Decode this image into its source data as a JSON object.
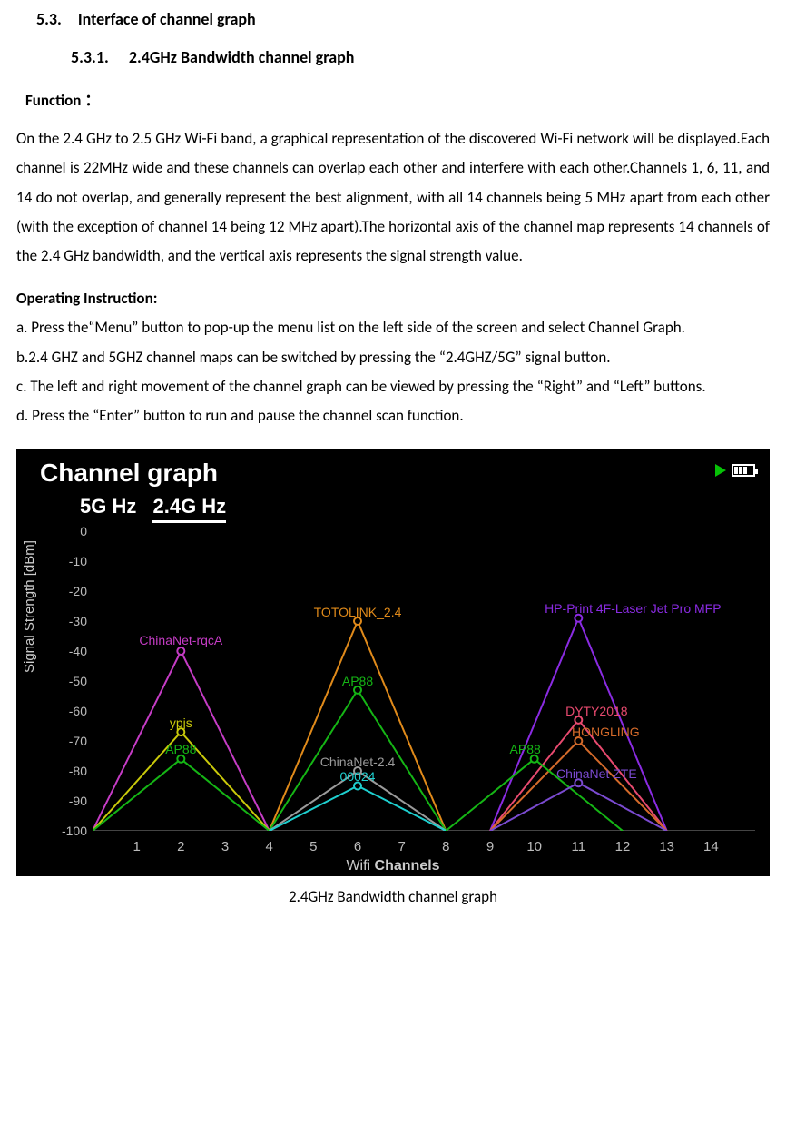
{
  "headings": {
    "section": "5.3. Interface of channel graph",
    "subsection": "5.3.1.  2.4GHz Bandwidth channel graph",
    "function_label": "Function ：",
    "operating_label": "Operating Instruction:"
  },
  "paragraphs": {
    "function_body": "On the 2.4 GHz to 2.5 GHz Wi-Fi band, a graphical representation of the discovered Wi-Fi network will be displayed.Each channel is 22MHz wide and these channels can overlap each other and interfere with each other.Channels 1, 6, 11, and 14 do not overlap, and generally represent the best alignment, with all 14 channels being 5 MHz apart from each other (with the exception of channel 14 being 12 MHz apart).The horizontal axis of the channel map represents 14 channels of the 2.4 GHz bandwidth, and the vertical axis represents the signal strength value.",
    "oi_a": "a. Press the“Menu” button to pop-up the menu list on the left side of the screen and select Channel Graph.",
    "oi_b": "b.2.4 GHZ and 5GHZ channel maps can be switched by pressing the “2.4GHZ/5G” signal button.",
    "oi_c": "c. The left and right movement of the channel graph can be viewed by pressing the “Right” and “Left” buttons.",
    "oi_d": "d. Press the “Enter” button to run and pause the channel scan function."
  },
  "screenshot": {
    "title": "Channel graph",
    "tabs": {
      "t0": "5G Hz",
      "t1": "2.4G Hz"
    },
    "ylabel": "Signal Strength [dBm]",
    "xlabel": "Wifi Channels",
    "yticks": [
      "0",
      "-10",
      "-20",
      "-30",
      "-40",
      "-50",
      "-60",
      "-70",
      "-80",
      "-90",
      "-100"
    ],
    "xticks": [
      "1",
      "2",
      "3",
      "4",
      "5",
      "6",
      "7",
      "8",
      "9",
      "10",
      "11",
      "12",
      "13",
      "14"
    ],
    "networks": {
      "n0": "ChinaNet-rqcA",
      "n1": "ypjs",
      "n2": "AP88",
      "n3": "TOTOLINK_2.4",
      "n4": "AP88",
      "n5": "ChinaNet-2.4",
      "n6": "00024",
      "n7": "HP-Print 4F-Laser Jet Pro MFP",
      "n8": "DYTY2018",
      "n9": "HONGLING",
      "n10": "AP88",
      "n11": "ChinaNet ZTE"
    }
  },
  "caption": "2.4GHz Bandwidth channel graph",
  "chart_data": {
    "type": "line",
    "title": "Channel graph",
    "xlabel": "Wifi Channels",
    "ylabel": "Signal Strength [dBm]",
    "ylim": [
      -100,
      0
    ],
    "xlim": [
      0,
      15
    ],
    "categories": [
      1,
      2,
      3,
      4,
      5,
      6,
      7,
      8,
      9,
      10,
      11,
      12,
      13,
      14
    ],
    "note": "Each series is a triangular shape spanning center_channel±2, peaking at the listed dBm",
    "series": [
      {
        "name": "ChinaNet-rqcA",
        "center_channel": 2,
        "peak_dbm": -40,
        "color": "#c53cc5"
      },
      {
        "name": "ypjs",
        "center_channel": 2,
        "peak_dbm": -67,
        "color": "#c9c90a"
      },
      {
        "name": "AP88",
        "center_channel": 2,
        "peak_dbm": -76,
        "color": "#15b515"
      },
      {
        "name": "TOTOLINK_2.4",
        "center_channel": 6,
        "peak_dbm": -30,
        "color": "#e08a1a"
      },
      {
        "name": "AP88",
        "center_channel": 6,
        "peak_dbm": -53,
        "color": "#15b515"
      },
      {
        "name": "ChinaNet-2.4",
        "center_channel": 6,
        "peak_dbm": -80,
        "color": "#9a9a9a"
      },
      {
        "name": "00024",
        "center_channel": 6,
        "peak_dbm": -85,
        "color": "#1ecfcf"
      },
      {
        "name": "HP-Print 4F-Laser Jet Pro MFP",
        "center_channel": 11,
        "peak_dbm": -29,
        "color": "#8a2be2"
      },
      {
        "name": "DYTY2018",
        "center_channel": 11,
        "peak_dbm": -63,
        "color": "#e84a6f"
      },
      {
        "name": "HONGLING",
        "center_channel": 11,
        "peak_dbm": -70,
        "color": "#d46a2a"
      },
      {
        "name": "AP88",
        "center_channel": 10,
        "peak_dbm": -76,
        "color": "#15b515"
      },
      {
        "name": "ChinaNet ZTE",
        "center_channel": 11,
        "peak_dbm": -84,
        "color": "#7a4ad0"
      }
    ]
  }
}
